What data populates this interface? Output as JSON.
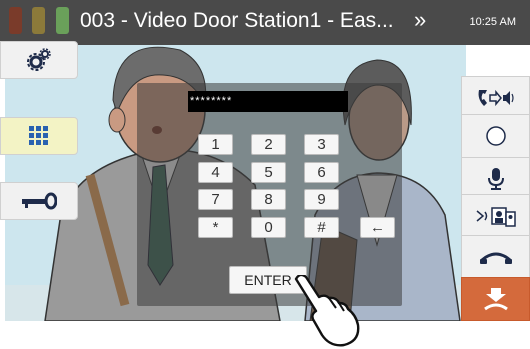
{
  "title_bar": {
    "title": "003 - Video Door Station1 - Eas...",
    "arrow_glyph": "»",
    "time": "10:25 AM",
    "camera_colors": [
      "#7a3b2a",
      "#8c7a3a",
      "#6aa05a"
    ]
  },
  "left_buttons": [
    {
      "name": "settings-gear-icon"
    },
    {
      "name": "keypad-grid-icon"
    },
    {
      "name": "key-unlock-icon"
    }
  ],
  "right_buttons": [
    {
      "name": "call-to-speaker-icon"
    },
    {
      "name": "record-circle-icon"
    },
    {
      "name": "microphone-icon"
    },
    {
      "name": "transfer-picture-icon"
    },
    {
      "name": "ring-handset-icon"
    },
    {
      "name": "hang-up-icon"
    }
  ],
  "keypad": {
    "password_value": "********",
    "keys": [
      "1",
      "2",
      "3",
      "4",
      "5",
      "6",
      "7",
      "8",
      "9",
      "*",
      "0",
      "#"
    ],
    "backspace_glyph": "←",
    "enter_label": "ENTER"
  },
  "colors": {
    "title_bar": "#4a4a4a",
    "keypad_button_highlight": "#f3f3c5",
    "hang_up": "#d46a3c",
    "icon_dark": "#1e2b4a"
  }
}
